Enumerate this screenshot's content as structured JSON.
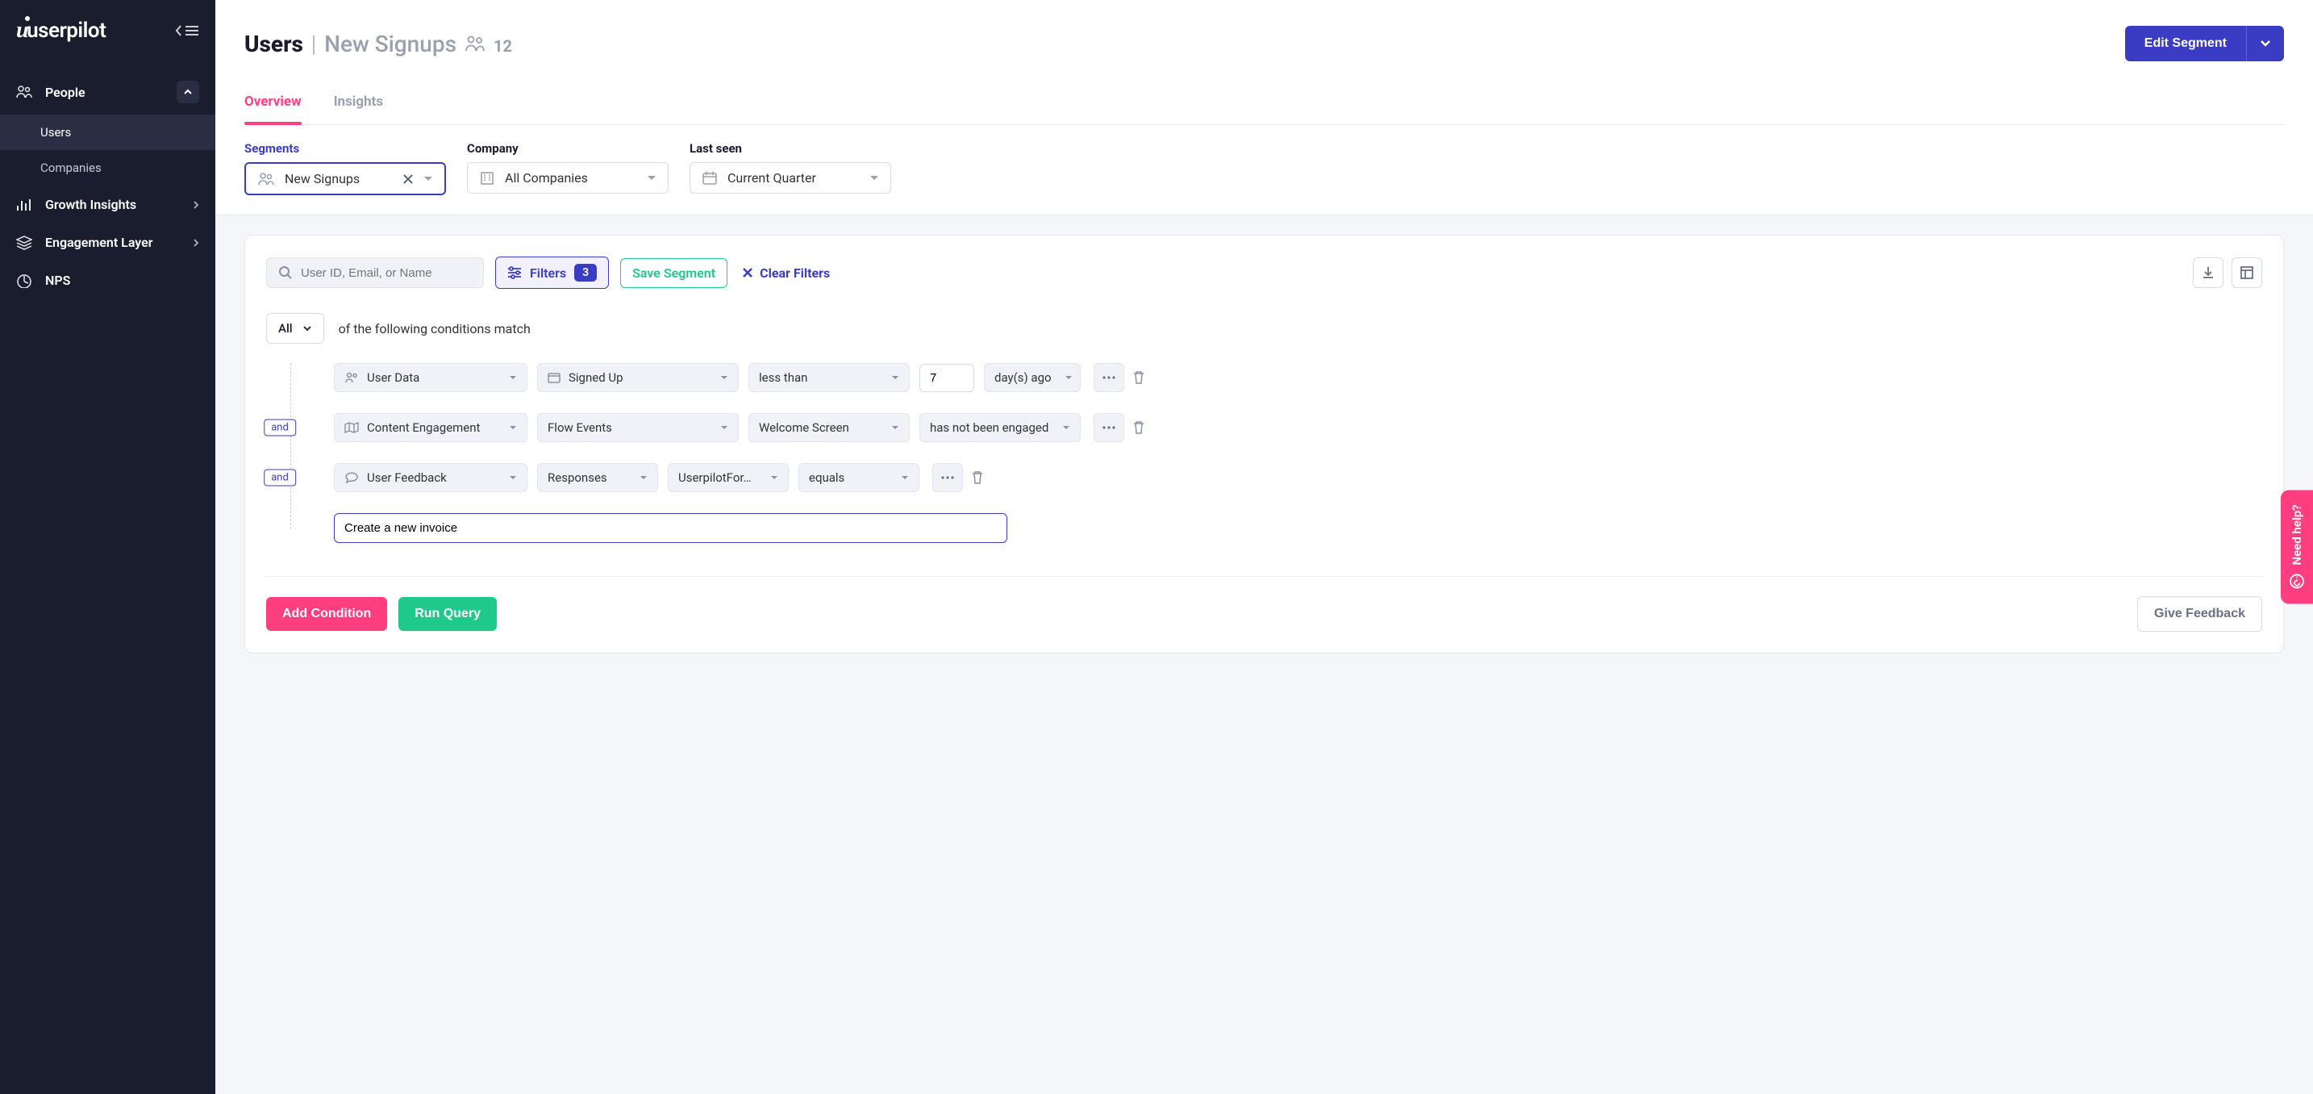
{
  "brand": "userpilot",
  "sidebar": {
    "sections": [
      {
        "label": "People",
        "expanded": true
      },
      {
        "label": "Growth Insights"
      },
      {
        "label": "Engagement Layer"
      },
      {
        "label": "NPS"
      }
    ],
    "people_items": [
      {
        "label": "Users",
        "active": true
      },
      {
        "label": "Companies"
      }
    ]
  },
  "header": {
    "title": "Users",
    "segment_name": "New Signups",
    "count": "12",
    "edit_button": "Edit Segment"
  },
  "tabs": [
    {
      "label": "Overview",
      "active": true
    },
    {
      "label": "Insights"
    }
  ],
  "filters": {
    "segments_label": "Segments",
    "segments_value": "New Signups",
    "company_label": "Company",
    "company_value": "All Companies",
    "lastseen_label": "Last seen",
    "lastseen_value": "Current Quarter"
  },
  "panel": {
    "search_placeholder": "User ID, Email, or Name",
    "filters_label": "Filters",
    "filters_count": "3",
    "save_segment": "Save Segment",
    "clear_filters": "Clear Filters",
    "all_label": "All",
    "cond_text": "of the following conditions match",
    "rows": [
      {
        "and": false,
        "source": "User Data",
        "attr": "Signed Up",
        "op": "less than",
        "value": "7",
        "unit": "day(s) ago"
      },
      {
        "and": true,
        "source": "Content Engagement",
        "attr": "Flow Events",
        "target": "Welcome Screen",
        "op": "has not been engaged"
      },
      {
        "and": true,
        "source": "User Feedback",
        "attr": "Responses",
        "target": "UserpilotFor…",
        "op": "equals"
      }
    ],
    "text_value": "Create a new invoice",
    "add_condition": "Add Condition",
    "run_query": "Run Query",
    "give_feedback": "Give Feedback"
  },
  "help_tab": "Need help?"
}
